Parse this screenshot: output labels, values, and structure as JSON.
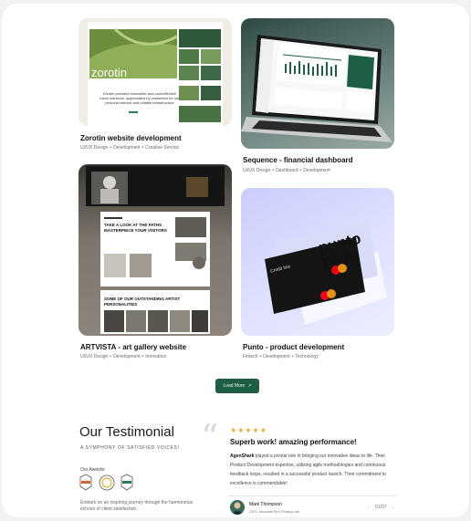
{
  "projects": [
    {
      "title": "Zorotin website development",
      "tags": [
        "UI/UX Design",
        "Development",
        "Creative Service"
      ],
      "screen_brand": "zorotin",
      "screen_text": "Zorotin provides innovative and cost-effective travel solutions, appreciated by customers for our personal service and reliable infrastructure"
    },
    {
      "title": "Sequence - financial dashboard",
      "tags": [
        "UI/UX Design",
        "Dashboard",
        "Development"
      ]
    },
    {
      "title": "ARTVISTA - art gallery website",
      "tags": [
        "UI/UX Design",
        "Development",
        "Innovation"
      ],
      "screen_heading_1": "TAKE A LOOK AT THE PATHS MASTERPIECE YOUR VISITORS",
      "screen_heading_2": "SOME OF OUR OUTSTANDING ARTIST PERSONALITIES"
    },
    {
      "title": "Punto - product development",
      "tags": [
        "Fintech",
        "Development",
        "Technology"
      ],
      "card_brand": "punto pago",
      "card_label": "Credit line"
    }
  ],
  "load_more": {
    "label": "Load More",
    "icon": "arrow-up-right-icon"
  },
  "testimonial": {
    "heading": "Our Testimonial",
    "subheading": "A SYMPHONY OF SATISFIED VOICES!",
    "awards_label": "Our Awards:",
    "tagline": "Embark on an inspiring journey through the harmonious echoes of client satisfaction.",
    "rating": 5,
    "review_title": "Superb work! amazing performance!",
    "review_company": "AgenShark",
    "review_text": " played a pivotal role in bringing our innovative ideas to life. Their Product Development expertise, utilizing agile methodologies and continuous feedback loops, resulted in a successful product launch. Their commitment to excellence is commendable!",
    "reviewer_name": "Mark Thompson",
    "reviewer_role": "CEO, InnovateTech Startup Inc.",
    "pager": "01/07"
  },
  "colors": {
    "accent": "#1e5e44",
    "star": "#e0b23b"
  }
}
